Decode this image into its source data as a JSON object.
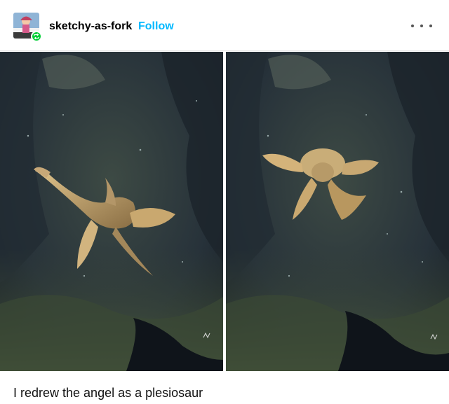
{
  "post": {
    "blog_name": "sketchy-as-fork",
    "follow_label": "Follow",
    "avatar_icon": "avatar-icon",
    "reblog_icon": "reblog-icon",
    "more_icon": "more-options-icon"
  },
  "images": [
    {
      "subject": "plesiosaur-side-view",
      "signature_icon": "artist-signature"
    },
    {
      "subject": "plesiosaur-front-view",
      "signature_icon": "artist-signature"
    }
  ],
  "caption": "I redrew the angel as a plesiosaur",
  "colors": {
    "follow": "#00b8ff",
    "reblog_badge": "#00cf35",
    "water_dark": "#1a2430",
    "water_mid": "#3a4a40"
  }
}
